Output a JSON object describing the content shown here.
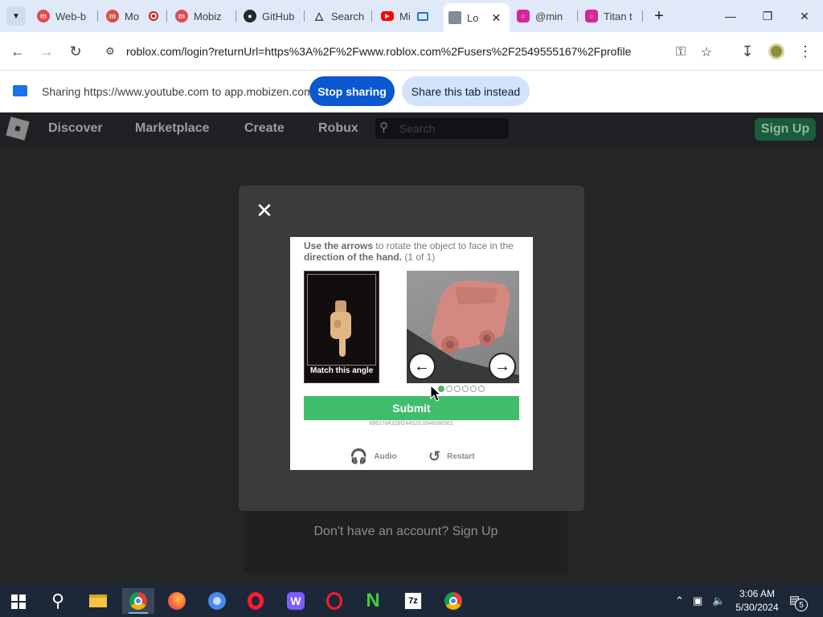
{
  "browser": {
    "tabs": [
      {
        "title": "Web-b",
        "icon": "mobizen-icon",
        "color": "#e5484d"
      },
      {
        "title": "Mo",
        "icon": "mobizen-icon",
        "color": "#e5484d",
        "recording": true
      },
      {
        "title": "Mobiz",
        "icon": "mobizen-icon",
        "color": "#e5484d"
      },
      {
        "title": "GitHub",
        "icon": "github-icon",
        "color": "#24292f"
      },
      {
        "title": "Search",
        "icon": "search-engine-icon",
        "color": "#333333"
      },
      {
        "title": "Mi",
        "icon": "youtube-icon",
        "color": "#ff0000",
        "casting": true
      },
      {
        "title": "Lo",
        "icon": "roblox-icon",
        "color": "#7f8c9a",
        "active": true
      },
      {
        "title": "@min",
        "icon": "instagram-icon",
        "color": "#d6249f"
      },
      {
        "title": "Titan t",
        "icon": "instagram-icon",
        "color": "#d6249f"
      }
    ],
    "url": "roblox.com/login?returnUrl=https%3A%2F%2Fwww.roblox.com%2Fusers%2F2549555167%2Fprofile"
  },
  "sharebar": {
    "message": "Sharing https://www.youtube.com to app.mobizen.com",
    "stop_label": "Stop sharing",
    "share_tab_label": "Share this tab instead"
  },
  "roblox": {
    "nav": [
      "Discover",
      "Marketplace",
      "Create",
      "Robux"
    ],
    "search_placeholder": "Search",
    "signup_label": "Sign Up",
    "no_account_text": "Don't have an account? Sign Up"
  },
  "captcha": {
    "instruction_part1": "Use the arrows",
    "instruction_part2": " to rotate the object ",
    "instruction_part3": "to face in the ",
    "instruction_part4": "direction of the hand.",
    "instruction_part5": " (1 of 1)",
    "reference_label": "Match this angle",
    "submit_label": "Submit",
    "session_id": "89517d4328f244523.0546086901",
    "audio_label": "Audio",
    "restart_label": "Restart",
    "progress_dots": 6,
    "current_dot": 1
  },
  "taskbar": {
    "time": "3:06 AM",
    "date": "5/30/2024",
    "notification_count": "5"
  }
}
